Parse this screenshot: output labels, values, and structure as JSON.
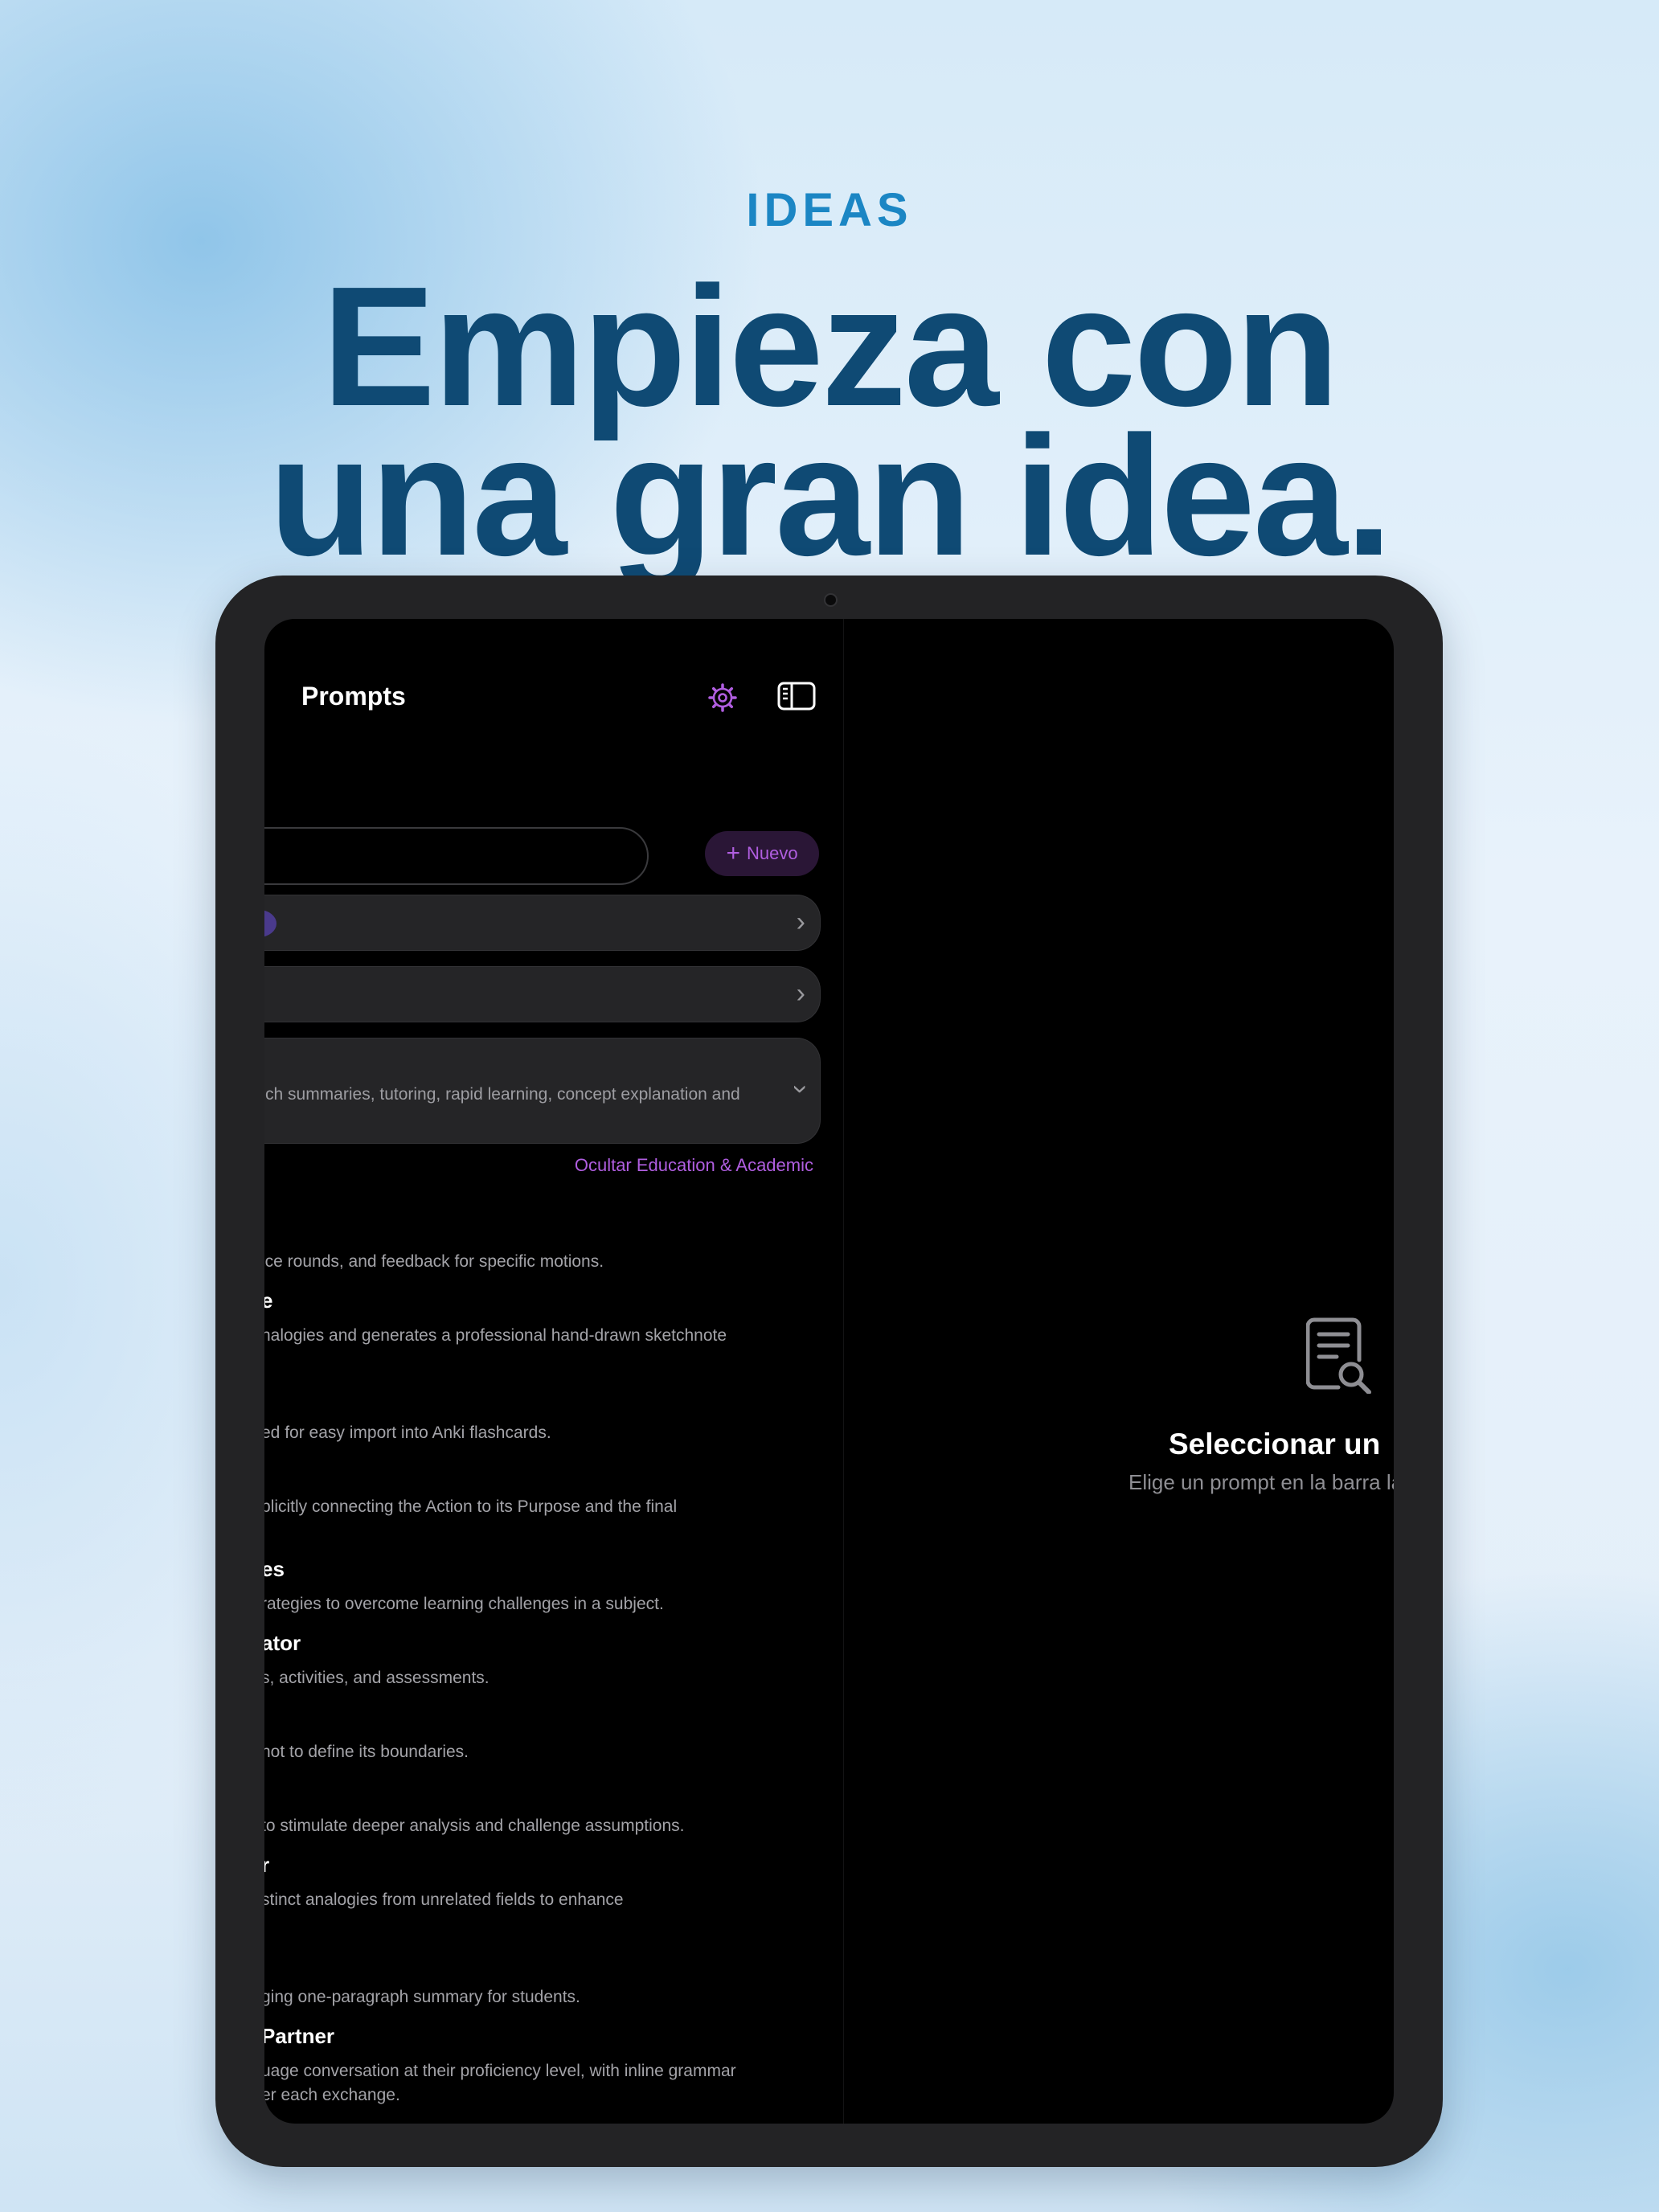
{
  "hero": {
    "eyebrow": "IDEAS",
    "headline_line1": "Empieza con",
    "headline_line2": "una gran idea."
  },
  "colors": {
    "eyebrow": "#1b86c4",
    "headline": "#0f4a74",
    "accent": "#b05ee0",
    "device_frame": "#232325",
    "screen_bg": "#000000"
  },
  "sidebar": {
    "title": "Prompts",
    "settings_icon": "gear-icon",
    "toggle_icon": "sidebar-toggle-icon",
    "new_button": {
      "icon": "plus-icon",
      "label": "Nuevo"
    },
    "category_rows": [
      {
        "text": "",
        "icon": "chevron-right-icon"
      },
      {
        "text": "",
        "icon": "chevron-right-icon"
      },
      {
        "text": "ch summaries, tutoring, rapid learning, concept explanation and",
        "icon": "chevron-down-icon"
      }
    ],
    "hide_link": "Ocultar Education & Academic",
    "items": [
      {
        "title": "",
        "desc": "ice rounds, and feedback for specific motions."
      },
      {
        "title": "e",
        "desc": "nalogies and generates a professional hand-drawn sketchnote"
      },
      {
        "title": "",
        "desc": "ed for easy import into Anki flashcards."
      },
      {
        "title": "",
        "desc": "plicitly connecting the Action to its Purpose and the final"
      },
      {
        "title": "es",
        "desc": "rategies to overcome learning challenges in a subject."
      },
      {
        "title": "ator",
        "desc": "s, activities, and assessments."
      },
      {
        "title": "",
        "desc": "not to define its boundaries."
      },
      {
        "title": "",
        "desc": "to stimulate deeper analysis and challenge assumptions."
      },
      {
        "title": "r",
        "desc": "stinct analogies from unrelated fields to enhance"
      },
      {
        "title": "",
        "desc": "ging one-paragraph summary for students."
      },
      {
        "title": "Partner",
        "desc": "uage conversation at their proficiency level, with inline grammar"
      }
    ],
    "last_item_extra": "er each exchange."
  },
  "detail": {
    "icon": "document-search-icon",
    "title": "Seleccionar un",
    "subtitle": "Elige un prompt en la barra latera"
  }
}
